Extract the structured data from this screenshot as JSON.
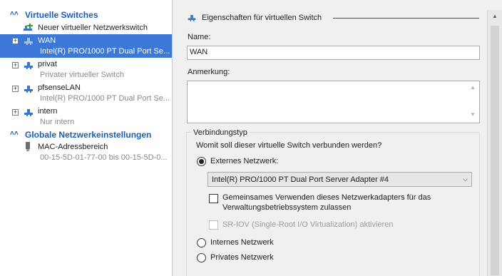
{
  "left_panel": {
    "sections": [
      {
        "title": "Virtuelle Switches"
      },
      {
        "title": "Globale Netzwerkeinstellungen"
      }
    ],
    "new_switch": "Neuer virtueller Netzwerkswitch",
    "switches": [
      {
        "name": "WAN",
        "subtitle": "Intel(R) PRO/1000 PT Dual Port Se...",
        "selected": true
      },
      {
        "name": "privat",
        "subtitle": "Privater virtueller Switch",
        "selected": false
      },
      {
        "name": "pfsenseLAN",
        "subtitle": "Intel(R) PRO/1000 PT Dual Port Se...",
        "selected": false
      },
      {
        "name": "intern",
        "subtitle": "Nur intern",
        "selected": false
      }
    ],
    "mac_range": {
      "title": "MAC-Adressbereich",
      "value": "00-15-5D-01-77-00 bis 00-15-5D-0..."
    }
  },
  "properties": {
    "header": "Eigenschaften für virtuellen Switch",
    "name_label": "Name:",
    "name_value": "WAN",
    "note_label": "Anmerkung:",
    "note_value": "",
    "connection_group": "Verbindungstyp",
    "connection_question": "Womit soll dieser virtuelle Switch verbunden werden?",
    "options": {
      "external": "Externes Netzwerk:",
      "adapter": "Intel(R) PRO/1000 PT Dual Port Server Adapter #4",
      "share_line1": "Gemeinsames Verwenden dieses Netzwerkadapters für das",
      "share_line2": "Verwaltungsbetriebssystem zulassen",
      "sriov": "SR-IOV (Single-Root I/O Virtualization) aktivieren",
      "internal": "Internes Netzwerk",
      "private": "Privates Netzwerk"
    },
    "selected_option": "external"
  },
  "colors": {
    "accent": "#1c5cb5",
    "selection": "#3d78d6"
  }
}
